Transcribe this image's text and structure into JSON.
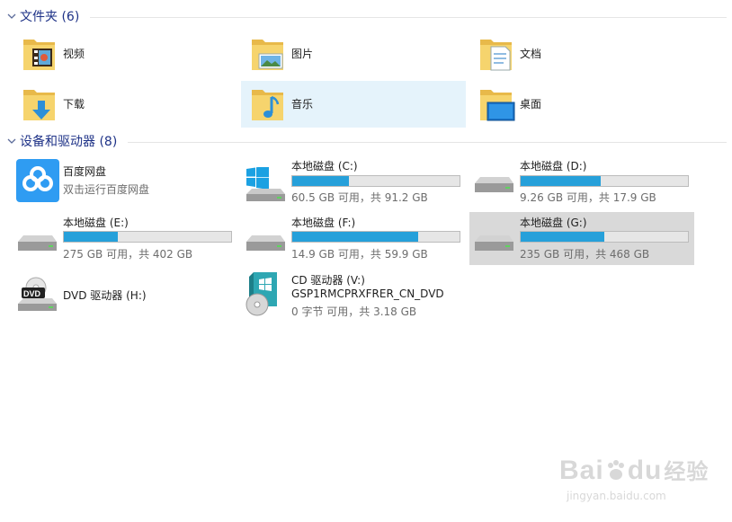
{
  "folders_section": {
    "title": "文件夹 (6)"
  },
  "folders": [
    {
      "label": "视频"
    },
    {
      "label": "图片"
    },
    {
      "label": "文档"
    },
    {
      "label": "下载"
    },
    {
      "label": "音乐"
    },
    {
      "label": "桌面"
    }
  ],
  "devices_section": {
    "title": "设备和驱动器 (8)"
  },
  "devices": {
    "baidu": {
      "label": "百度网盘",
      "sub": "双击运行百度网盘"
    },
    "c": {
      "label": "本地磁盘 (C:)",
      "sub": "60.5 GB 可用，共 91.2 GB",
      "used_percent": 34
    },
    "d": {
      "label": "本地磁盘 (D:)",
      "sub": "9.26 GB 可用，共 17.9 GB",
      "used_percent": 48
    },
    "e": {
      "label": "本地磁盘 (E:)",
      "sub": "275 GB 可用，共 402 GB",
      "used_percent": 32
    },
    "f": {
      "label": "本地磁盘 (F:)",
      "sub": "14.9 GB 可用，共 59.9 GB",
      "used_percent": 75
    },
    "g": {
      "label": "本地磁盘 (G:)",
      "sub": "235 GB 可用，共 468 GB",
      "used_percent": 50
    },
    "h": {
      "label": "DVD 驱动器 (H:)",
      "badge": "DVD"
    },
    "v": {
      "label": "CD 驱动器 (V:)",
      "volume": "GSP1RMCPRXFRER_CN_DVD",
      "sub": "0 字节 可用，共 3.18 GB"
    }
  },
  "watermark": {
    "brand": "Bai",
    "brand_mid": "du",
    "brand_cn": "经验",
    "url": "jingyan.baidu.com"
  },
  "colors": {
    "accent": "#26a0da",
    "header": "#1e3287",
    "selection": "#e5f3fb"
  }
}
